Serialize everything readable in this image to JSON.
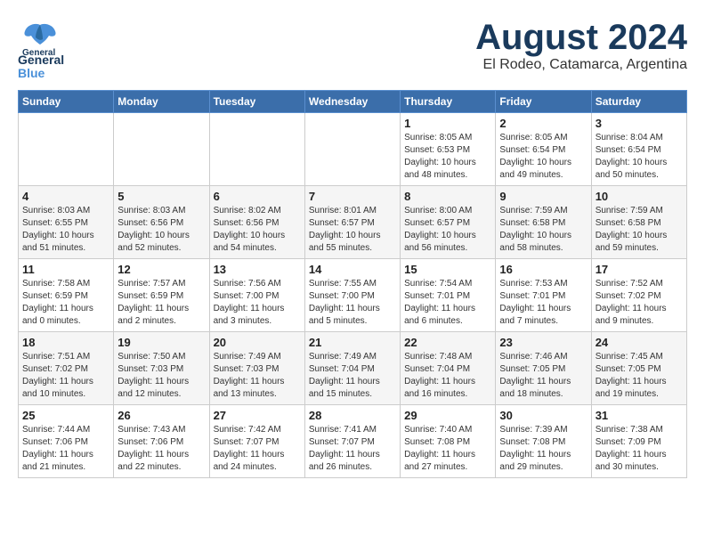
{
  "header": {
    "logo_general": "General",
    "logo_blue": "Blue",
    "title": "August 2024",
    "subtitle": "El Rodeo, Catamarca, Argentina"
  },
  "days_of_week": [
    "Sunday",
    "Monday",
    "Tuesday",
    "Wednesday",
    "Thursday",
    "Friday",
    "Saturday"
  ],
  "weeks": [
    [
      {
        "day": "",
        "info": ""
      },
      {
        "day": "",
        "info": ""
      },
      {
        "day": "",
        "info": ""
      },
      {
        "day": "",
        "info": ""
      },
      {
        "day": "1",
        "info": "Sunrise: 8:05 AM\nSunset: 6:53 PM\nDaylight: 10 hours\nand 48 minutes."
      },
      {
        "day": "2",
        "info": "Sunrise: 8:05 AM\nSunset: 6:54 PM\nDaylight: 10 hours\nand 49 minutes."
      },
      {
        "day": "3",
        "info": "Sunrise: 8:04 AM\nSunset: 6:54 PM\nDaylight: 10 hours\nand 50 minutes."
      }
    ],
    [
      {
        "day": "4",
        "info": "Sunrise: 8:03 AM\nSunset: 6:55 PM\nDaylight: 10 hours\nand 51 minutes."
      },
      {
        "day": "5",
        "info": "Sunrise: 8:03 AM\nSunset: 6:56 PM\nDaylight: 10 hours\nand 52 minutes."
      },
      {
        "day": "6",
        "info": "Sunrise: 8:02 AM\nSunset: 6:56 PM\nDaylight: 10 hours\nand 54 minutes."
      },
      {
        "day": "7",
        "info": "Sunrise: 8:01 AM\nSunset: 6:57 PM\nDaylight: 10 hours\nand 55 minutes."
      },
      {
        "day": "8",
        "info": "Sunrise: 8:00 AM\nSunset: 6:57 PM\nDaylight: 10 hours\nand 56 minutes."
      },
      {
        "day": "9",
        "info": "Sunrise: 7:59 AM\nSunset: 6:58 PM\nDaylight: 10 hours\nand 58 minutes."
      },
      {
        "day": "10",
        "info": "Sunrise: 7:59 AM\nSunset: 6:58 PM\nDaylight: 10 hours\nand 59 minutes."
      }
    ],
    [
      {
        "day": "11",
        "info": "Sunrise: 7:58 AM\nSunset: 6:59 PM\nDaylight: 11 hours\nand 0 minutes."
      },
      {
        "day": "12",
        "info": "Sunrise: 7:57 AM\nSunset: 6:59 PM\nDaylight: 11 hours\nand 2 minutes."
      },
      {
        "day": "13",
        "info": "Sunrise: 7:56 AM\nSunset: 7:00 PM\nDaylight: 11 hours\nand 3 minutes."
      },
      {
        "day": "14",
        "info": "Sunrise: 7:55 AM\nSunset: 7:00 PM\nDaylight: 11 hours\nand 5 minutes."
      },
      {
        "day": "15",
        "info": "Sunrise: 7:54 AM\nSunset: 7:01 PM\nDaylight: 11 hours\nand 6 minutes."
      },
      {
        "day": "16",
        "info": "Sunrise: 7:53 AM\nSunset: 7:01 PM\nDaylight: 11 hours\nand 7 minutes."
      },
      {
        "day": "17",
        "info": "Sunrise: 7:52 AM\nSunset: 7:02 PM\nDaylight: 11 hours\nand 9 minutes."
      }
    ],
    [
      {
        "day": "18",
        "info": "Sunrise: 7:51 AM\nSunset: 7:02 PM\nDaylight: 11 hours\nand 10 minutes."
      },
      {
        "day": "19",
        "info": "Sunrise: 7:50 AM\nSunset: 7:03 PM\nDaylight: 11 hours\nand 12 minutes."
      },
      {
        "day": "20",
        "info": "Sunrise: 7:49 AM\nSunset: 7:03 PM\nDaylight: 11 hours\nand 13 minutes."
      },
      {
        "day": "21",
        "info": "Sunrise: 7:49 AM\nSunset: 7:04 PM\nDaylight: 11 hours\nand 15 minutes."
      },
      {
        "day": "22",
        "info": "Sunrise: 7:48 AM\nSunset: 7:04 PM\nDaylight: 11 hours\nand 16 minutes."
      },
      {
        "day": "23",
        "info": "Sunrise: 7:46 AM\nSunset: 7:05 PM\nDaylight: 11 hours\nand 18 minutes."
      },
      {
        "day": "24",
        "info": "Sunrise: 7:45 AM\nSunset: 7:05 PM\nDaylight: 11 hours\nand 19 minutes."
      }
    ],
    [
      {
        "day": "25",
        "info": "Sunrise: 7:44 AM\nSunset: 7:06 PM\nDaylight: 11 hours\nand 21 minutes."
      },
      {
        "day": "26",
        "info": "Sunrise: 7:43 AM\nSunset: 7:06 PM\nDaylight: 11 hours\nand 22 minutes."
      },
      {
        "day": "27",
        "info": "Sunrise: 7:42 AM\nSunset: 7:07 PM\nDaylight: 11 hours\nand 24 minutes."
      },
      {
        "day": "28",
        "info": "Sunrise: 7:41 AM\nSunset: 7:07 PM\nDaylight: 11 hours\nand 26 minutes."
      },
      {
        "day": "29",
        "info": "Sunrise: 7:40 AM\nSunset: 7:08 PM\nDaylight: 11 hours\nand 27 minutes."
      },
      {
        "day": "30",
        "info": "Sunrise: 7:39 AM\nSunset: 7:08 PM\nDaylight: 11 hours\nand 29 minutes."
      },
      {
        "day": "31",
        "info": "Sunrise: 7:38 AM\nSunset: 7:09 PM\nDaylight: 11 hours\nand 30 minutes."
      }
    ]
  ]
}
